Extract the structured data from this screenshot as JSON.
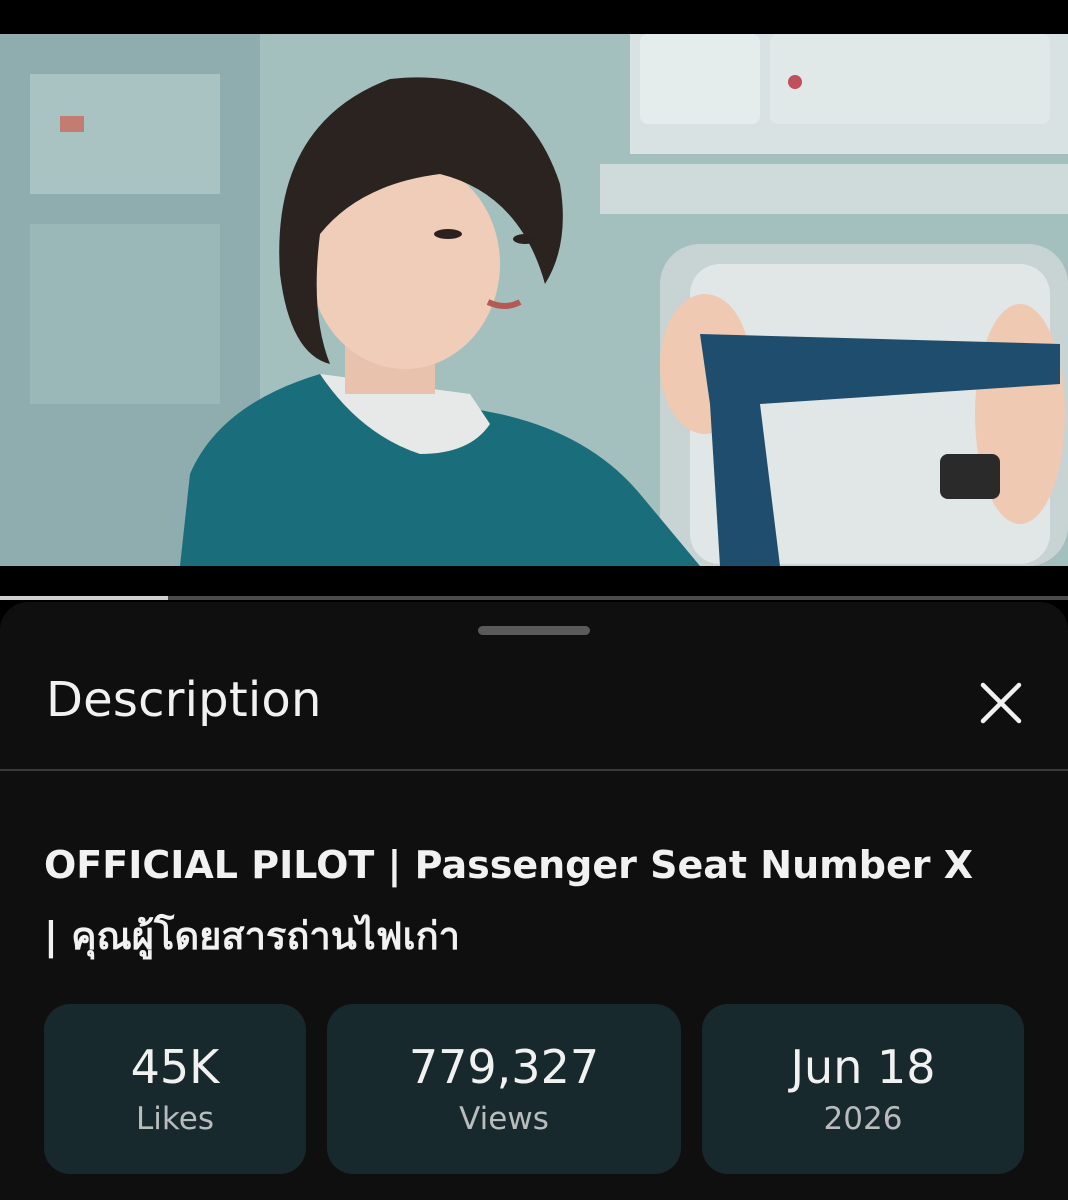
{
  "video": {
    "playback_progress": 0.157
  },
  "description_sheet": {
    "title": "Description",
    "close_icon": "close-icon"
  },
  "video_info": {
    "title_line1": "OFFICIAL PILOT | Passenger Seat Number X",
    "title_line2": "| คุณผู้โดยสารถ่านไฟเก่า"
  },
  "stats": {
    "likes": {
      "value": "45K",
      "label": "Likes"
    },
    "views": {
      "value": "779,327",
      "label": "Views"
    },
    "date": {
      "value": "Jun 18",
      "label": "2026"
    }
  },
  "colors": {
    "background": "#0f0f0f",
    "stat_card": "#17292d",
    "progress_fill": "#cfcfcf"
  }
}
